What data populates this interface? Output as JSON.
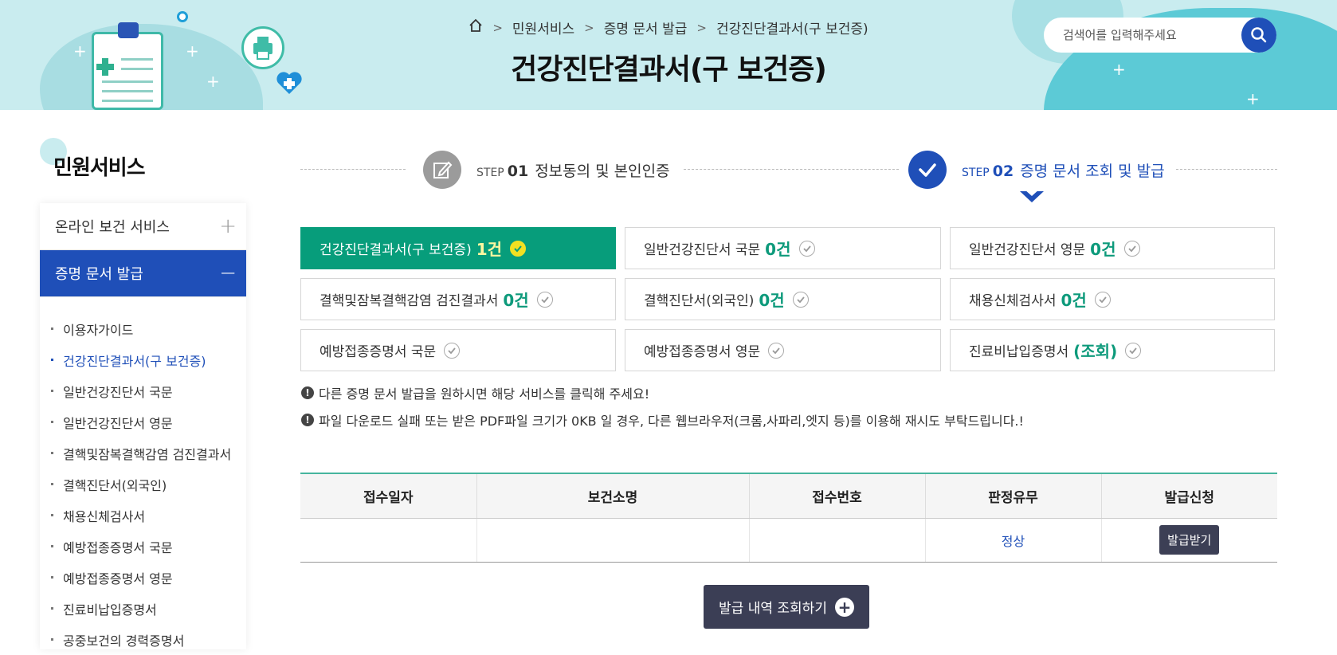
{
  "breadcrumb": [
    "민원서비스",
    "증명 문서 발급",
    "건강진단결과서(구 보건증)"
  ],
  "page_title": "건강진단결과서(구 보건증)",
  "search": {
    "placeholder": "검색어를 입력해주세요"
  },
  "sidebar": {
    "title": "민원서비스",
    "menus": [
      {
        "label": "온라인 보건 서비스",
        "toggle": "+"
      },
      {
        "label": "증명 문서 발급",
        "toggle": "−"
      }
    ],
    "sub_items": [
      "이용자가이드",
      "건강진단결과서(구 보건증)",
      "일반건강진단서 국문",
      "일반건강진단서 영문",
      "결핵및잠복결핵감염 검진결과서",
      "결핵진단서(외국인)",
      "채용신체검사서",
      "예방접종증명서 국문",
      "예방접종증명서 영문",
      "진료비납입증명서",
      "공중보건의 경력증명서"
    ]
  },
  "steps": {
    "step1": {
      "label": "STEP",
      "num": "01",
      "text": "정보동의 및 본인인증"
    },
    "step2": {
      "label": "STEP",
      "num": "02",
      "text": "증명 문서 조회 및 발급"
    }
  },
  "docs": [
    {
      "name": "건강진단결과서(구 보건증)",
      "count": "1건"
    },
    {
      "name": "일반건강진단서 국문",
      "count": "0건"
    },
    {
      "name": "일반건강진단서 영문",
      "count": "0건"
    },
    {
      "name": "결핵및잠복결핵감염 검진결과서",
      "count": "0건"
    },
    {
      "name": "결핵진단서(외국인)",
      "count": "0건"
    },
    {
      "name": "채용신체검사서",
      "count": "0건"
    },
    {
      "name": "예방접종증명서 국문",
      "count": ""
    },
    {
      "name": "예방접종증명서 영문",
      "count": ""
    },
    {
      "name": "진료비납입증명서",
      "count": "(조회)"
    }
  ],
  "notices": [
    "다른 증명 문서 발급을 원하시면 해당 서비스를 클릭해 주세요!",
    "파일 다운로드 실패 또는 받은 PDF파일 크기가 0KB 일 경우, 다른 웹브라우저(크롬,사파리,엣지 등)를 이용해 재시도 부탁드립니다.!"
  ],
  "table": {
    "headers": [
      "접수일자",
      "보건소명",
      "접수번호",
      "판정유무",
      "발급신청"
    ],
    "row": {
      "date": "",
      "center": "",
      "number": "",
      "status": "정상",
      "action": "발급받기"
    }
  },
  "history_button": "발급 내역 조회하기",
  "colors": {
    "primary": "#1f4fb8",
    "green": "#079d7b",
    "dark_button": "#3c3f55",
    "banner": "#c9ecef"
  }
}
